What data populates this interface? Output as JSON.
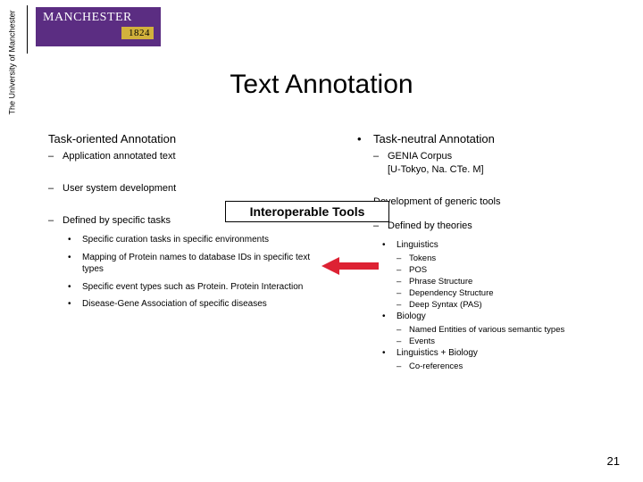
{
  "brand": {
    "name": "MANCHESTER",
    "year": "1824",
    "sideways": "The University of Manchester"
  },
  "title": "Text Annotation",
  "left": {
    "heading": "Task-oriented Annotation",
    "b1": "Application annotated text",
    "b2": "User system development",
    "b3": "Defined by specific tasks",
    "sub": [
      "Specific curation tasks in specific environments",
      "Mapping of Protein names to database IDs in specific text types",
      "Specific event types such as Protein. Protein Interaction",
      "Disease-Gene Association of specific diseases"
    ]
  },
  "right": {
    "heading": "Task-neutral Annotation",
    "b1a": "GENIA Corpus",
    "b1b": "[U-Tokyo, Na. CTe. M]",
    "b2": "Development of generic tools",
    "b3": "Defined by theories",
    "tree": {
      "ling": "Linguistics",
      "ling_items": [
        "Tokens",
        "POS",
        "Phrase Structure",
        "Dependency Structure",
        "Deep Syntax (PAS)"
      ],
      "bio": "Biology",
      "bio_items": [
        "Named Entities of various semantic types",
        "Events"
      ],
      "lb": "Linguistics + Biology",
      "lb_items": [
        "Co-references"
      ]
    }
  },
  "interop": "Interoperable Tools",
  "pagenum": "21"
}
